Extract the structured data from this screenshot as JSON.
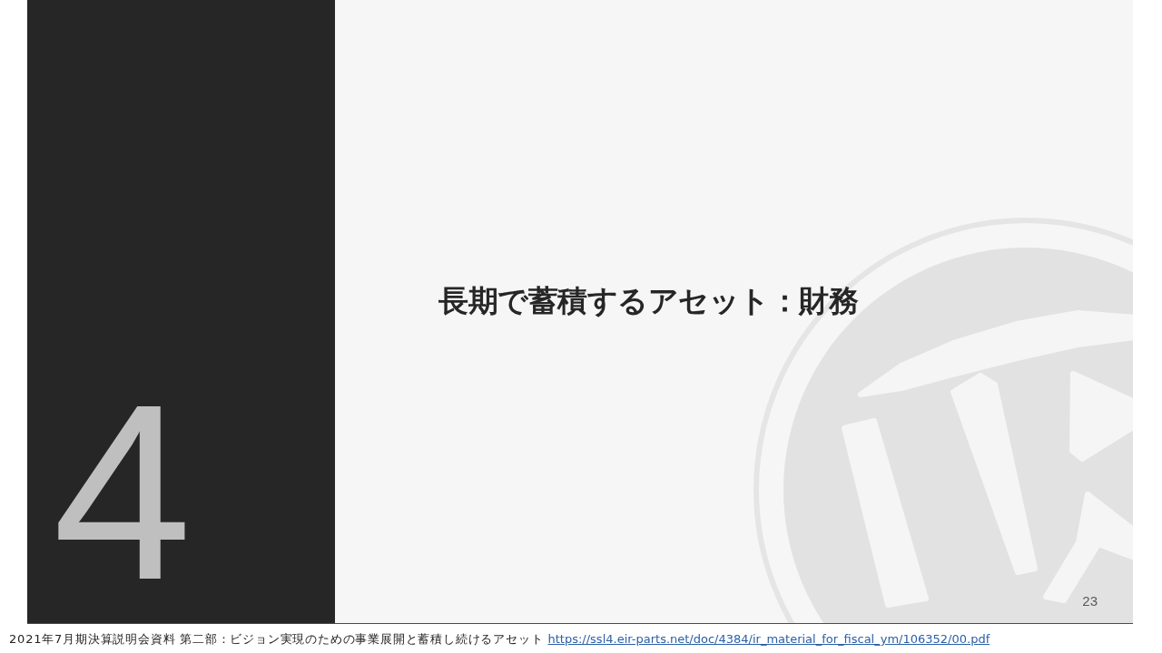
{
  "slide": {
    "section_number": "4",
    "title": "長期で蓄積するアセット：財務",
    "page_number": "23"
  },
  "caption": {
    "text": "2021年7月期決算説明会資料 第二部：ビジョン実現のための事業展開と蓄積し続けるアセット",
    "link": "https://ssl4.eir-parts.net/doc/4384/ir_material_for_fiscal_ym/106352/00.pdf"
  }
}
